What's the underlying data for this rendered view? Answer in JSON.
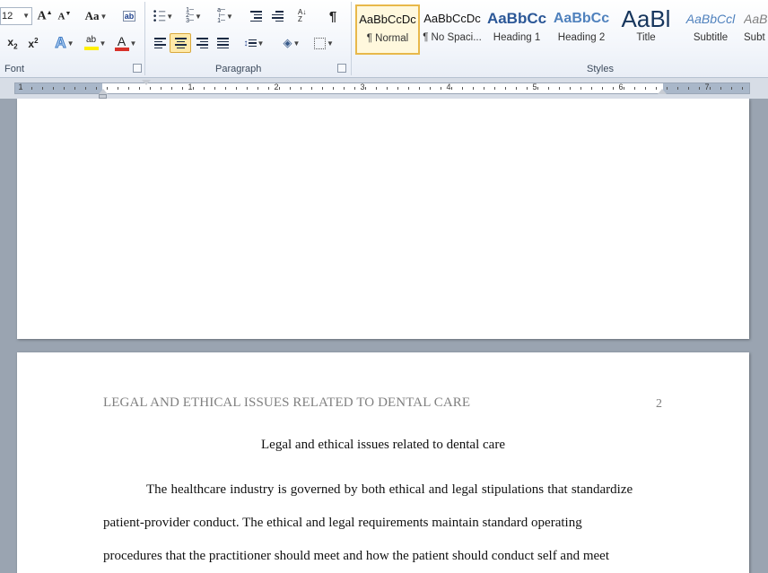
{
  "ribbon": {
    "font_group": {
      "label": "Font",
      "font_size": "12",
      "grow_font": "A",
      "shrink_font": "A",
      "change_case": "Aa",
      "subscript": "x",
      "superscript": "x",
      "highlight_text": "ab",
      "font_color_text": "A",
      "highlight_color": "#ffef00",
      "font_color": "#d8322a"
    },
    "paragraph_group": {
      "label": "Paragraph",
      "sort_glyph": "A↓Z",
      "show_marks_glyph": "¶"
    },
    "styles_group": {
      "label": "Styles",
      "items": [
        {
          "preview": "AaBbCcDc",
          "name": "¶ Normal"
        },
        {
          "preview": "AaBbCcDc",
          "name": "¶ No Spaci..."
        },
        {
          "preview": "AaBbCc",
          "name": "Heading 1"
        },
        {
          "preview": "AaBbCc",
          "name": "Heading 2"
        },
        {
          "preview": "AaBl",
          "name": "Title"
        },
        {
          "preview": "AaBbCcl",
          "name": "Subtitle"
        },
        {
          "preview": "AaB",
          "name": "Subt"
        }
      ]
    }
  },
  "ruler": {
    "numbers": [
      "1",
      "1",
      "2",
      "3",
      "4",
      "5",
      "6",
      "7"
    ]
  },
  "document": {
    "running_head": "LEGAL AND ETHICAL ISSUES RELATED TO DENTAL CARE",
    "page_number": "2",
    "title": "Legal and ethical issues related to dental care",
    "paragraph_lines": [
      "The healthcare industry is governed by both ethical and legal stipulations that standardize",
      "patient-provider conduct. The ethical and legal requirements maintain standard operating",
      "procedures that the practitioner should meet and how the patient should conduct self and meet"
    ]
  }
}
